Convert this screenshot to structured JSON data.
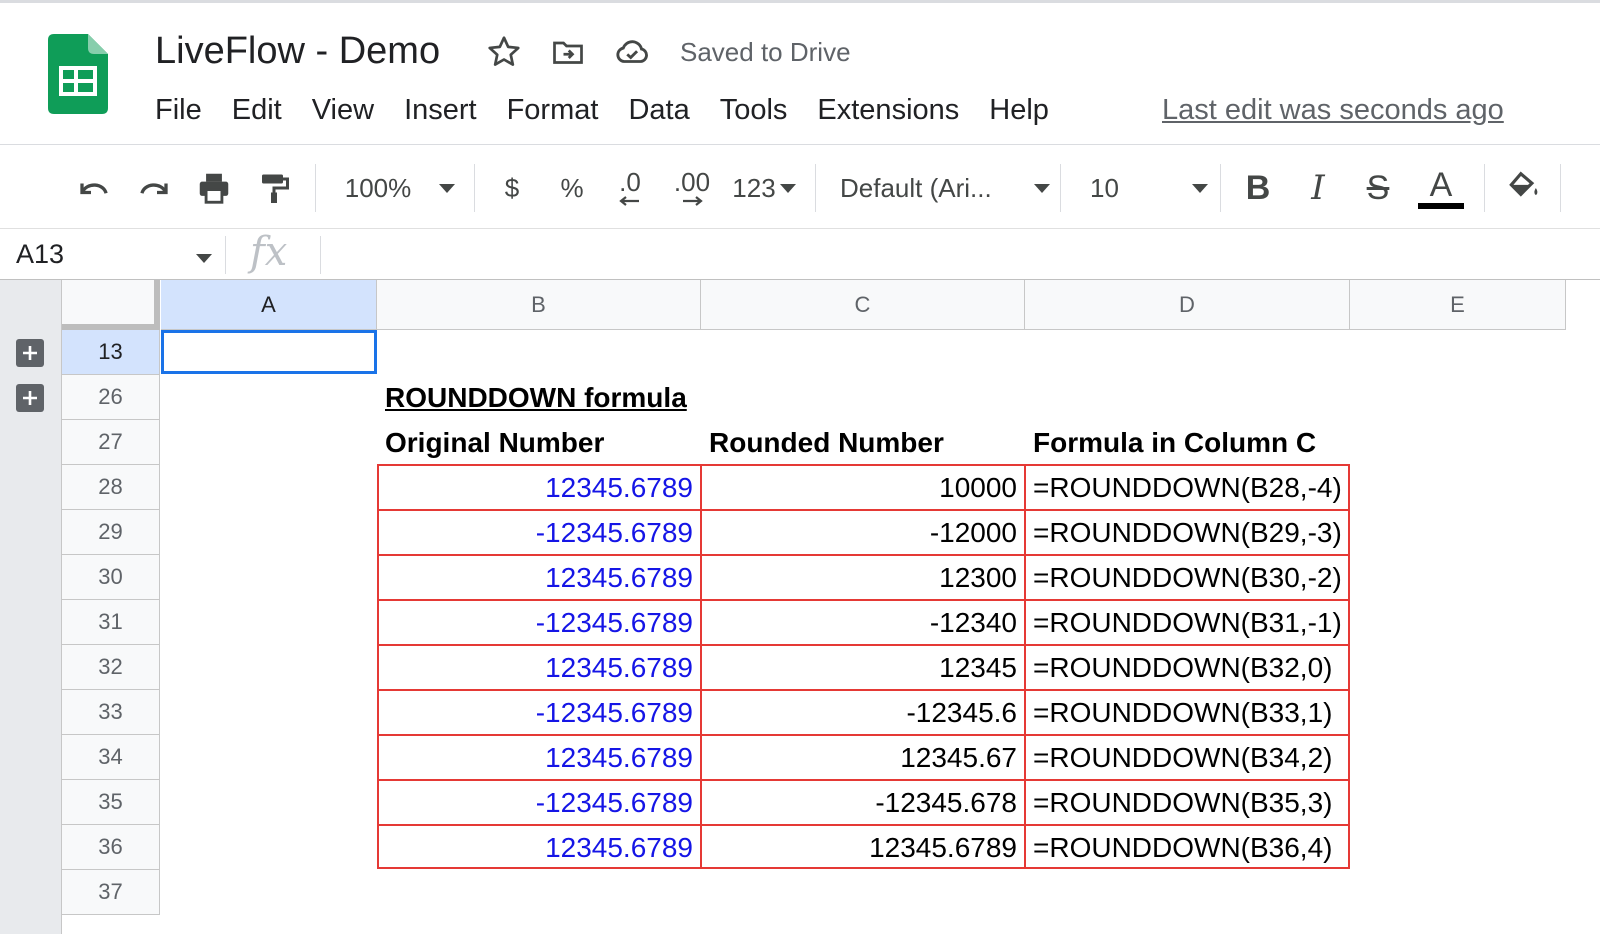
{
  "app": {
    "doc_title": "LiveFlow - Demo",
    "saved_status": "Saved to Drive",
    "last_edit": "Last edit was seconds ago",
    "logo_icon": "google-sheets-logo",
    "brand_color": "#0f9d58"
  },
  "menu": [
    "File",
    "Edit",
    "View",
    "Insert",
    "Format",
    "Data",
    "Tools",
    "Extensions",
    "Help"
  ],
  "toolbar": {
    "zoom": "100%",
    "currency": "$",
    "percent": "%",
    "decrease_decimal": ".0",
    "increase_decimal": ".00",
    "more_formats": "123",
    "font": "Default (Ari...",
    "font_size": "10",
    "bold": "B",
    "italic": "I",
    "strikethrough": "S",
    "text_color": "A"
  },
  "formula_bar": {
    "name_box": "A13",
    "fx": "fx",
    "formula": ""
  },
  "grid": {
    "columns": [
      "A",
      "B",
      "C",
      "D",
      "E"
    ],
    "selected_column": "A",
    "rows": [
      "13",
      "26",
      "27",
      "28",
      "29",
      "30",
      "31",
      "32",
      "33",
      "34",
      "35",
      "36",
      "37"
    ],
    "selected_row": "13",
    "selected_cell": "A13"
  },
  "sheet": {
    "section_title": "ROUNDDOWN formula",
    "headers": [
      "Original Number",
      "Rounded Number",
      "Formula in Column C"
    ],
    "rows": [
      {
        "original": "12345.6789",
        "rounded": "10000",
        "formula": "=ROUNDDOWN(B28,-4)"
      },
      {
        "original": "-12345.6789",
        "rounded": "-12000",
        "formula": "=ROUNDDOWN(B29,-3)"
      },
      {
        "original": "12345.6789",
        "rounded": "12300",
        "formula": "=ROUNDDOWN(B30,-2)"
      },
      {
        "original": "-12345.6789",
        "rounded": "-12340",
        "formula": "=ROUNDDOWN(B31,-1)"
      },
      {
        "original": "12345.6789",
        "rounded": "12345",
        "formula": "=ROUNDDOWN(B32,0)"
      },
      {
        "original": "-12345.6789",
        "rounded": "-12345.6",
        "formula": "=ROUNDDOWN(B33,1)"
      },
      {
        "original": "12345.6789",
        "rounded": "12345.67",
        "formula": "=ROUNDDOWN(B34,2)"
      },
      {
        "original": "-12345.6789",
        "rounded": "-12345.678",
        "formula": "=ROUNDDOWN(B35,3)"
      },
      {
        "original": "12345.6789",
        "rounded": "12345.6789",
        "formula": "=ROUNDDOWN(B36,4)"
      }
    ],
    "number_color": "#1515e6",
    "border_color": "#e53935"
  }
}
